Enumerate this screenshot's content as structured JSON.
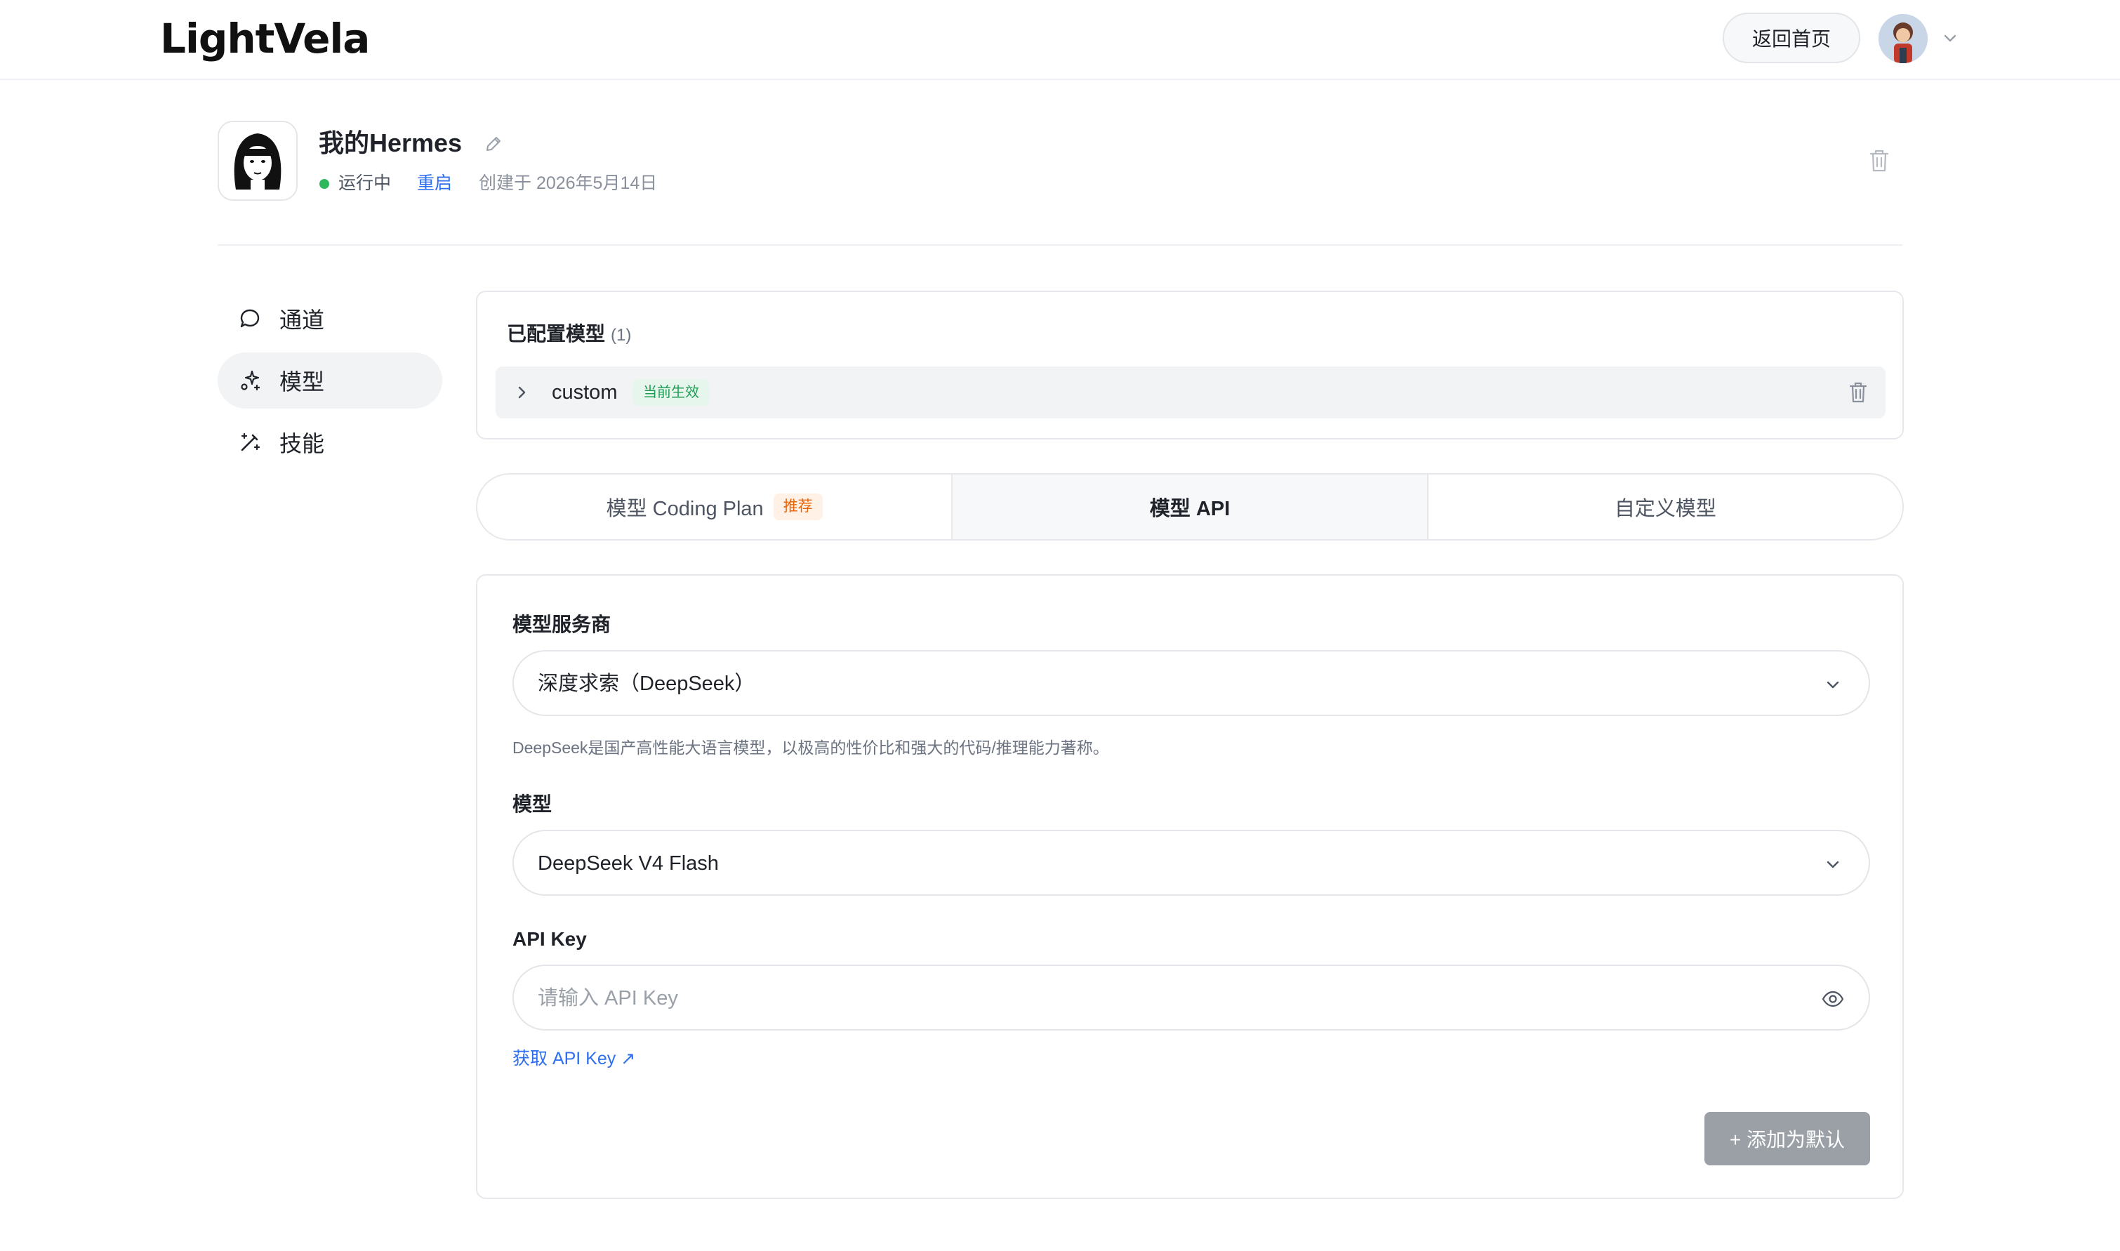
{
  "app": {
    "logo": "LightVela",
    "home_button": "返回首页"
  },
  "agent": {
    "name": "我的Hermes",
    "status": "运行中",
    "restart": "重启",
    "created": "创建于 2026年5月14日"
  },
  "sidebar": {
    "items": [
      {
        "label": "通道",
        "icon": "chat-bubble-icon",
        "active": false
      },
      {
        "label": "模型",
        "icon": "sparkle-icon",
        "active": true
      },
      {
        "label": "技能",
        "icon": "magic-wand-icon",
        "active": false
      }
    ]
  },
  "configured": {
    "title": "已配置模型",
    "count": "(1)",
    "models": [
      {
        "name": "custom",
        "badge": "当前生效"
      }
    ]
  },
  "tabs": [
    {
      "label": "模型 Coding Plan",
      "badge": "推荐",
      "active": false
    },
    {
      "label": "模型 API",
      "active": true
    },
    {
      "label": "自定义模型",
      "active": false
    }
  ],
  "form": {
    "provider_label": "模型服务商",
    "provider_value": "深度求索（DeepSeek）",
    "provider_hint": "DeepSeek是国产高性能大语言模型，以极高的性价比和强大的代码/推理能力著称。",
    "model_label": "模型",
    "model_value": "DeepSeek V4 Flash",
    "api_key_label": "API Key",
    "api_key_value": "",
    "api_key_placeholder": "请输入 API Key",
    "get_key_link": "获取 API Key ↗",
    "add_button": "+ 添加为默认"
  },
  "colors": {
    "status_green": "#2eb85c",
    "link_blue": "#2f6fed",
    "badge_green_text": "#1f9d55",
    "badge_orange_text": "#e8650a",
    "disabled_button": "#9aa0a6"
  }
}
